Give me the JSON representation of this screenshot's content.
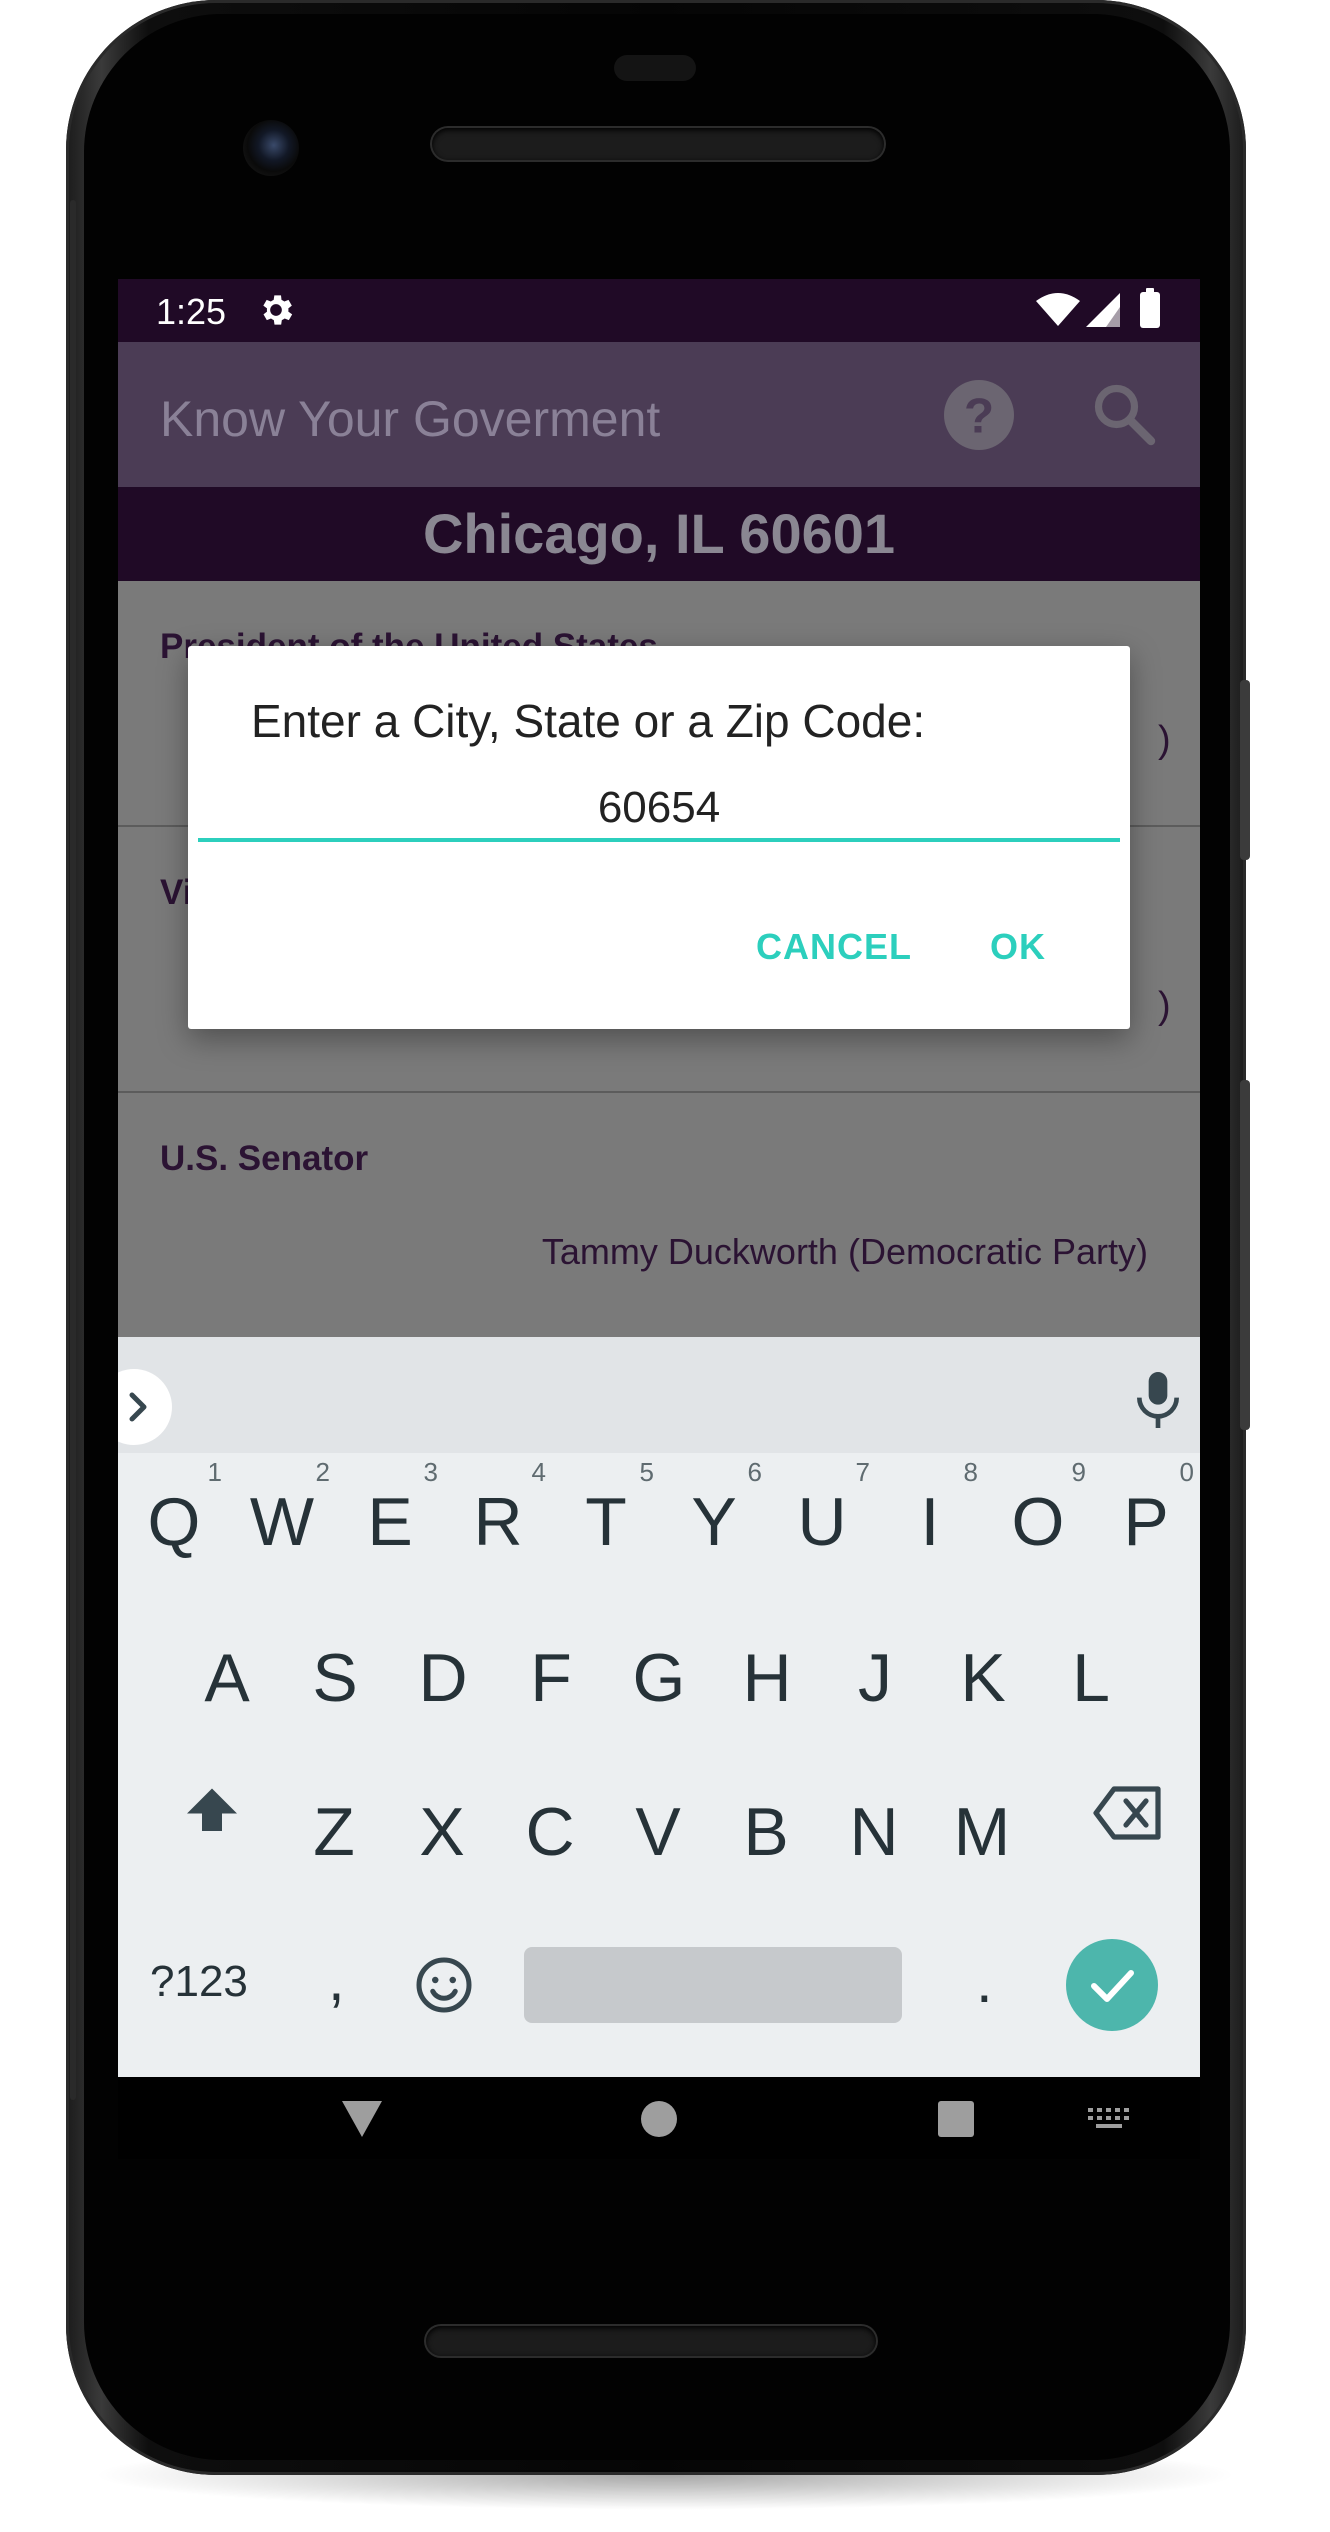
{
  "status_bar": {
    "time": "1:25",
    "icons": [
      "settings-gear-icon",
      "wifi-icon",
      "cell-signal-icon",
      "battery-icon"
    ]
  },
  "app_bar": {
    "title": "Know Your Goverment",
    "actions": [
      "help-icon",
      "search-icon"
    ]
  },
  "location": "Chicago, IL 60601",
  "offices": [
    {
      "title": "President of the United States",
      "name": ""
    },
    {
      "title": "Vi",
      "name": ""
    },
    {
      "title": "U.S. Senator",
      "name": "Tammy Duckworth (Democratic Party)"
    }
  ],
  "dialog": {
    "title": "Enter a City, State or a Zip Code:",
    "input_value": "60654",
    "cancel_label": "CANCEL",
    "ok_label": "OK"
  },
  "keyboard": {
    "row1": [
      {
        "k": "Q",
        "h": "1"
      },
      {
        "k": "W",
        "h": "2"
      },
      {
        "k": "E",
        "h": "3"
      },
      {
        "k": "R",
        "h": "4"
      },
      {
        "k": "T",
        "h": "5"
      },
      {
        "k": "Y",
        "h": "6"
      },
      {
        "k": "U",
        "h": "7"
      },
      {
        "k": "I",
        "h": "8"
      },
      {
        "k": "O",
        "h": "9"
      },
      {
        "k": "P",
        "h": "0"
      }
    ],
    "row2": [
      "A",
      "S",
      "D",
      "F",
      "G",
      "H",
      "J",
      "K",
      "L"
    ],
    "row3": [
      "Z",
      "X",
      "C",
      "V",
      "B",
      "N",
      "M"
    ],
    "symbols_label": "?123",
    "comma_label": ",",
    "period_label": "."
  },
  "colors": {
    "status_bar": "#200a26",
    "app_bar": "#4b3c55",
    "accent": "#2ccfbd",
    "enter_key": "#4db6ac"
  }
}
